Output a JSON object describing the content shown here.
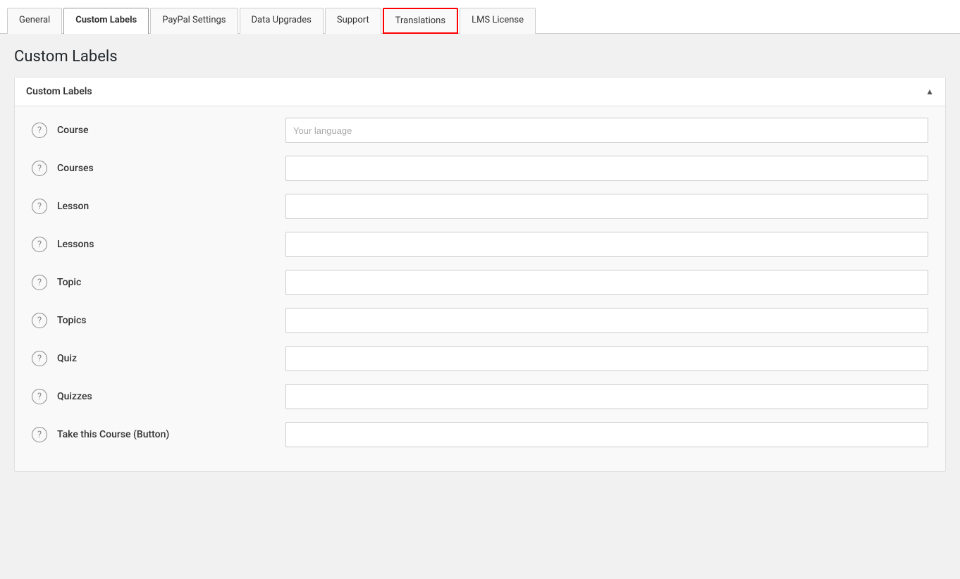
{
  "tabs": [
    {
      "id": "general",
      "label": "General",
      "active": false,
      "highlighted": false
    },
    {
      "id": "custom-labels",
      "label": "Custom Labels",
      "active": true,
      "highlighted": false
    },
    {
      "id": "paypal-settings",
      "label": "PayPal Settings",
      "active": false,
      "highlighted": false
    },
    {
      "id": "data-upgrades",
      "label": "Data Upgrades",
      "active": false,
      "highlighted": false
    },
    {
      "id": "support",
      "label": "Support",
      "active": false,
      "highlighted": false
    },
    {
      "id": "translations",
      "label": "Translations",
      "active": false,
      "highlighted": true
    },
    {
      "id": "lms-license",
      "label": "LMS License",
      "active": false,
      "highlighted": false
    }
  ],
  "page_title": "Custom Labels",
  "section": {
    "title": "Custom Labels",
    "collapse_icon": "▲"
  },
  "fields": [
    {
      "id": "course",
      "label": "Course",
      "placeholder": "Your language",
      "value": ""
    },
    {
      "id": "courses",
      "label": "Courses",
      "placeholder": "",
      "value": ""
    },
    {
      "id": "lesson",
      "label": "Lesson",
      "placeholder": "",
      "value": ""
    },
    {
      "id": "lessons",
      "label": "Lessons",
      "placeholder": "",
      "value": ""
    },
    {
      "id": "topic",
      "label": "Topic",
      "placeholder": "",
      "value": ""
    },
    {
      "id": "topics",
      "label": "Topics",
      "placeholder": "",
      "value": ""
    },
    {
      "id": "quiz",
      "label": "Quiz",
      "placeholder": "",
      "value": ""
    },
    {
      "id": "quizzes",
      "label": "Quizzes",
      "placeholder": "",
      "value": ""
    },
    {
      "id": "take-this-course",
      "label": "Take this Course (Button)",
      "placeholder": "",
      "value": ""
    }
  ],
  "help_icon_label": "?"
}
